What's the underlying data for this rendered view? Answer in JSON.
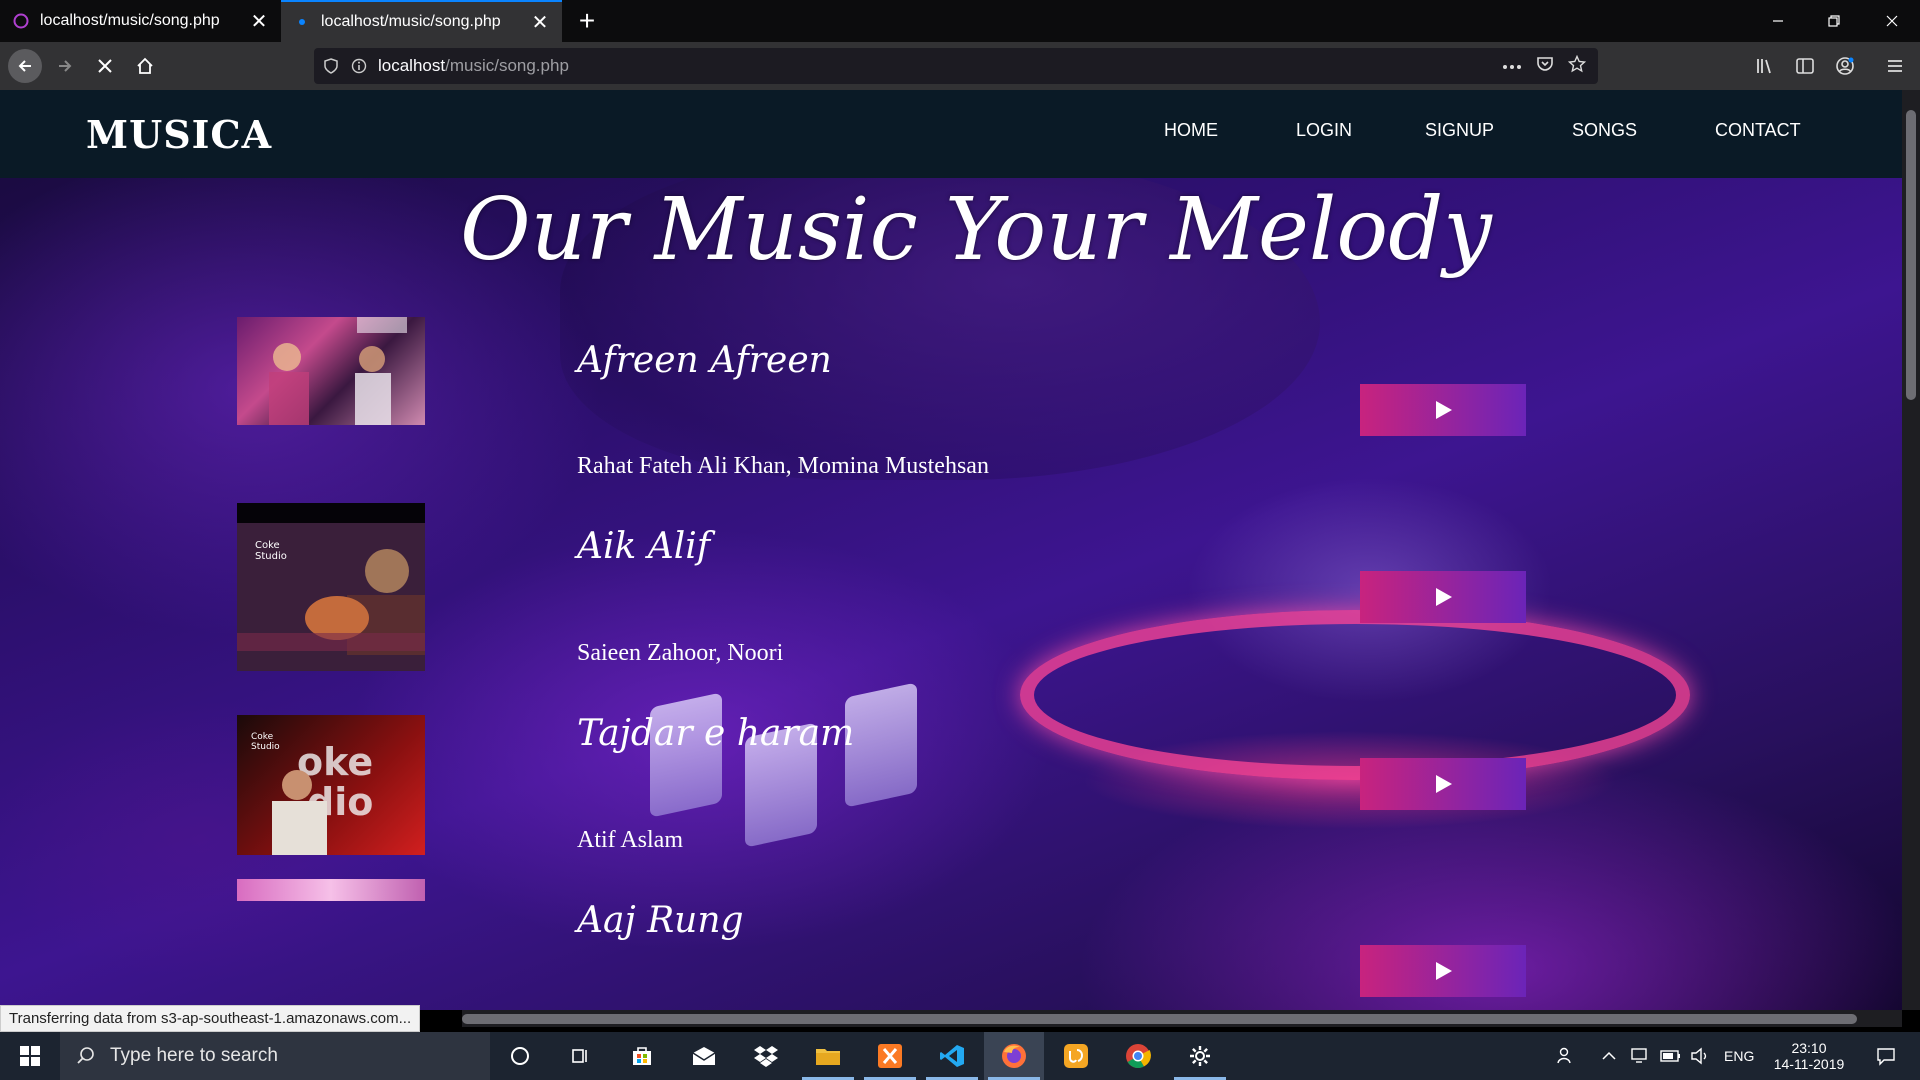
{
  "browser": {
    "tabs": [
      {
        "title": "localhost/music/song.php",
        "active": false
      },
      {
        "title": "localhost/music/song.php",
        "active": true
      }
    ],
    "url_host": "localhost",
    "url_path": "/music/song.php",
    "status_text": "Transferring data from s3-ap-southeast-1.amazonaws.com..."
  },
  "site": {
    "logo": "MUSICA",
    "menu": [
      "HOME",
      "LOGIN",
      "SIGNUP",
      "SONGS",
      "CONTACT"
    ],
    "hero": "Our Music Your Melody",
    "songs": [
      {
        "title": "Afreen Afreen",
        "artist": "Rahat Fateh Ali Khan, Momina Mustehsan"
      },
      {
        "title": "Aik Alif",
        "artist": "Saieen Zahoor, Noori"
      },
      {
        "title": "Tajdar e haram",
        "artist": "Atif Aslam"
      },
      {
        "title": "Aaj Rung",
        "artist": ""
      }
    ]
  },
  "taskbar": {
    "search_placeholder": "Type here to search",
    "lang": "ENG",
    "time": "23:10",
    "date": "14-11-2019"
  },
  "colors": {
    "header_bg": "#0a1a26",
    "play_gradient_start": "#c8237e",
    "play_gradient_end": "#6b24b8",
    "accent_tab": "#0a84ff"
  }
}
